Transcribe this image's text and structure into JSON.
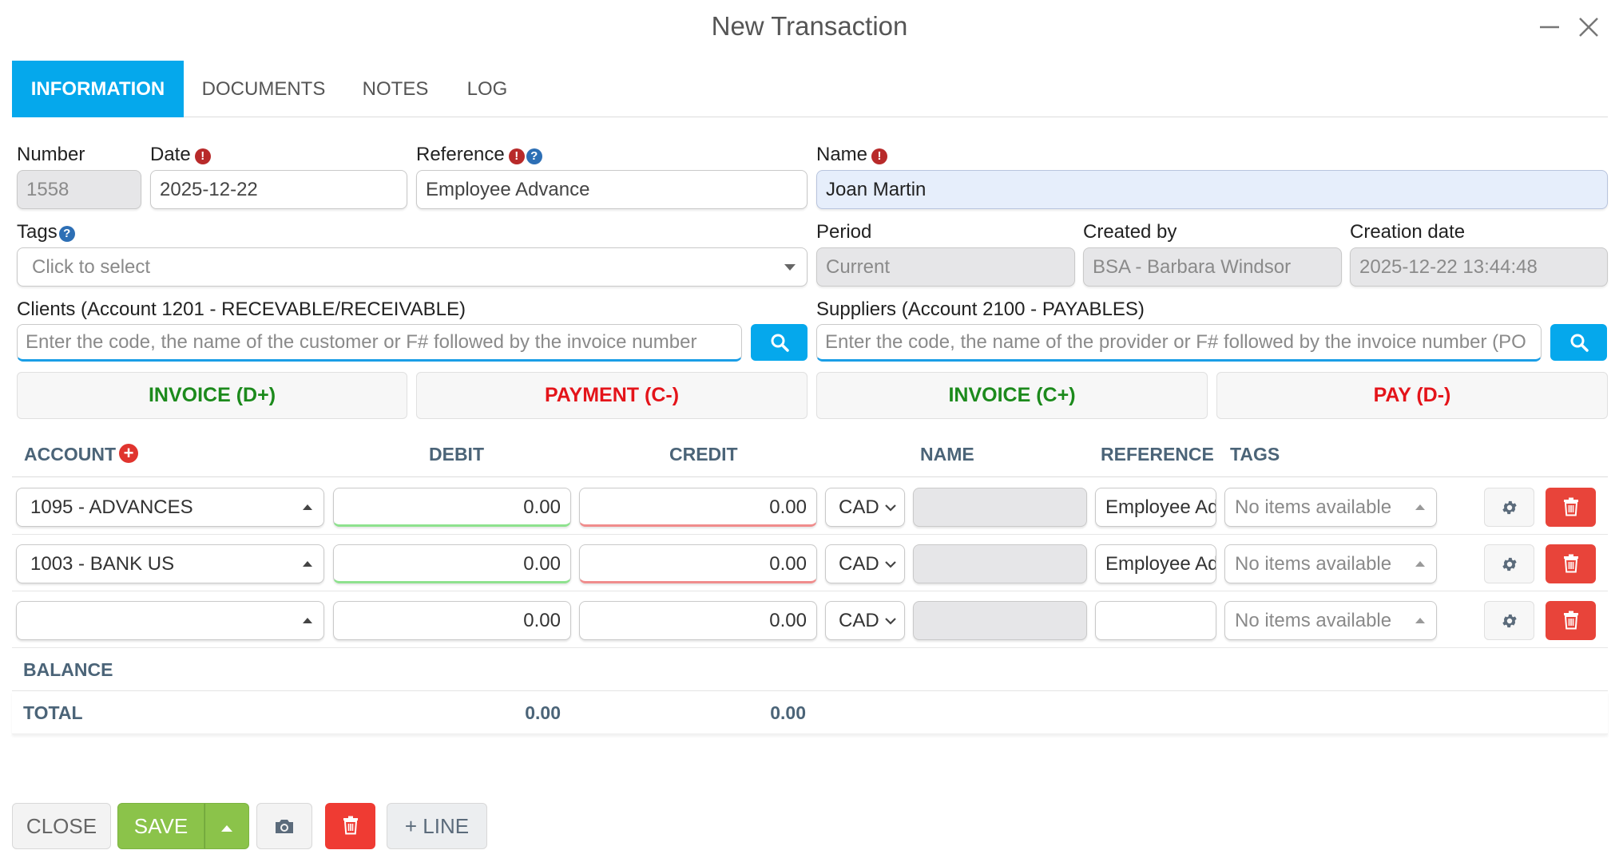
{
  "window": {
    "title": "New Transaction"
  },
  "tabs": [
    {
      "label": "INFORMATION"
    },
    {
      "label": "DOCUMENTS"
    },
    {
      "label": "NOTES"
    },
    {
      "label": "LOG"
    }
  ],
  "form": {
    "number": {
      "label": "Number",
      "value": "1558"
    },
    "date": {
      "label": "Date",
      "value": "2025-12-22"
    },
    "reference": {
      "label": "Reference",
      "value": "Employee Advance"
    },
    "name": {
      "label": "Name",
      "value": "Joan Martin"
    },
    "tags": {
      "label": "Tags",
      "placeholder": "Click to select"
    },
    "period": {
      "label": "Period",
      "value": "Current"
    },
    "created_by": {
      "label": "Created by",
      "value": "BSA - Barbara Windsor"
    },
    "creation_date": {
      "label": "Creation date",
      "value": "2025-12-22 13:44:48"
    },
    "clients": {
      "label": "Clients (Account 1201 - RECEVABLE/RECEIVABLE)",
      "placeholder": "Enter the code, the name of the customer or F# followed by the invoice number"
    },
    "suppliers": {
      "label": "Suppliers (Account 2100 - PAYABLES)",
      "placeholder": "Enter the code, the name of the provider or F# followed by the invoice number (PO"
    }
  },
  "actions": {
    "invoice_d": "INVOICE (D+)",
    "payment_c": "PAYMENT (C-)",
    "invoice_c": "INVOICE (C+)",
    "pay_d": "PAY (D-)"
  },
  "grid": {
    "headers": {
      "account": "ACCOUNT",
      "debit": "DEBIT",
      "credit": "CREDIT",
      "name": "NAME",
      "reference": "REFERENCE",
      "tags": "TAGS"
    },
    "rows": [
      {
        "account": "1095 - ADVANCES",
        "debit": "0.00",
        "credit": "0.00",
        "currency": "CAD",
        "name": "",
        "reference": "Employee Advance",
        "tags": "No items available"
      },
      {
        "account": "1003 - BANK US",
        "debit": "0.00",
        "credit": "0.00",
        "currency": "CAD",
        "name": "",
        "reference": "Employee Advance",
        "tags": "No items available"
      },
      {
        "account": "",
        "debit": "0.00",
        "credit": "0.00",
        "currency": "CAD",
        "name": "",
        "reference": "",
        "tags": "No items available"
      }
    ],
    "balance_label": "BALANCE",
    "total_label": "TOTAL",
    "total_debit": "0.00",
    "total_credit": "0.00"
  },
  "footer": {
    "close": "CLOSE",
    "save": "SAVE",
    "add_line": "+ LINE"
  }
}
